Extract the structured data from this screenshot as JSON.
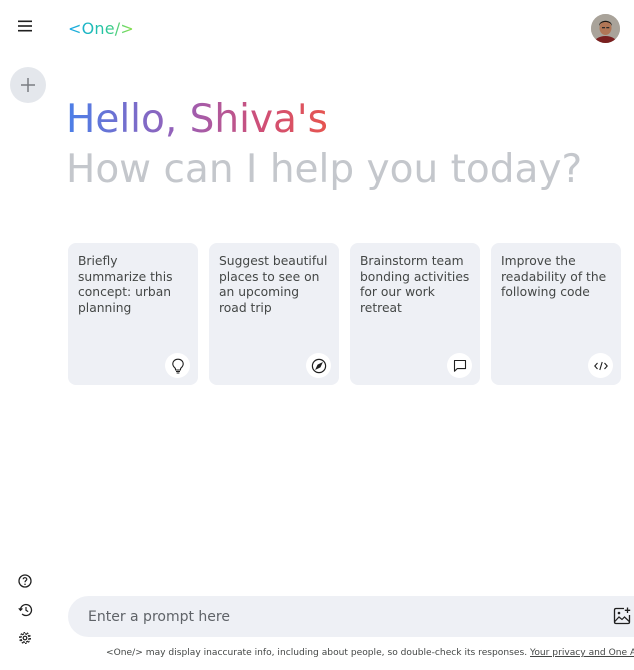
{
  "app": {
    "logo": "<One/>"
  },
  "sidebar": {
    "menu_icon": "hamburger-menu-icon",
    "new_chat_icon": "plus-icon",
    "bottom_icons": [
      "help-icon",
      "history-icon",
      "settings-icon"
    ]
  },
  "header": {
    "avatar_icon": "user-avatar"
  },
  "hero": {
    "greeting": "Hello, Shiva's",
    "subtitle": "How can I help you today?"
  },
  "cards": [
    {
      "text": "Briefly summarize this concept: urban planning",
      "icon": "lightbulb-icon"
    },
    {
      "text": "Suggest beautiful places to see on an upcoming road trip",
      "icon": "compass-icon"
    },
    {
      "text": "Brainstorm team bonding activities for our work retreat",
      "icon": "chat-bubble-icon"
    },
    {
      "text": "Improve the readability of the following code",
      "icon": "code-icon"
    }
  ],
  "prompt": {
    "placeholder": "Enter a prompt here",
    "image_icon": "add-image-icon"
  },
  "footer": {
    "disclaimer": "<One/> may display inaccurate info, including about people, so double-check its responses.",
    "link": "Your privacy and One Apps"
  },
  "colors": {
    "card_bg": "#eef0f5",
    "subtitle": "#c4c7cc",
    "greeting_gradient": [
      "#4b7fe8",
      "#9b5fb5",
      "#e6554f"
    ],
    "logo_gradient": [
      "#1aa7e8",
      "#8fe04a"
    ]
  }
}
